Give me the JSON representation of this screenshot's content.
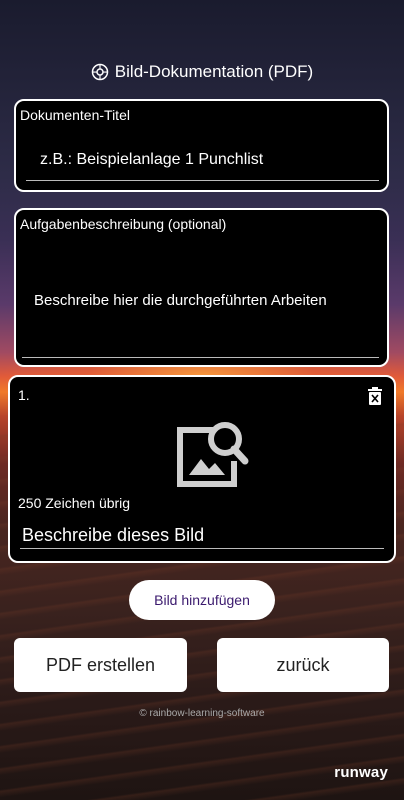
{
  "header": {
    "title": "Bild-Dokumentation (PDF)",
    "icon": "camera-icon"
  },
  "doc_title_field": {
    "label": "Dokumenten-Titel",
    "placeholder": "z.B.: Beispielanlage 1 Punchlist"
  },
  "description_field": {
    "label": "Aufgabenbeschreibung (optional)",
    "placeholder": "Beschreibe hier die durchgeführten Arbeiten"
  },
  "image_card": {
    "index": "1.",
    "remaining": "250 Zeichen übrig",
    "caption_placeholder": "Beschreibe dieses Bild",
    "image_icon": "image-search-icon",
    "delete_icon": "trash-icon"
  },
  "buttons": {
    "add_image": "Bild hinzufügen",
    "create_pdf": "PDF erstellen",
    "back": "zurück"
  },
  "footer": {
    "copyright": "© rainbow-learning-software",
    "brand": "runway"
  },
  "colors": {
    "pill_text": "#3b1a6e",
    "box_bg": "#000000",
    "border": "#ffffff"
  }
}
